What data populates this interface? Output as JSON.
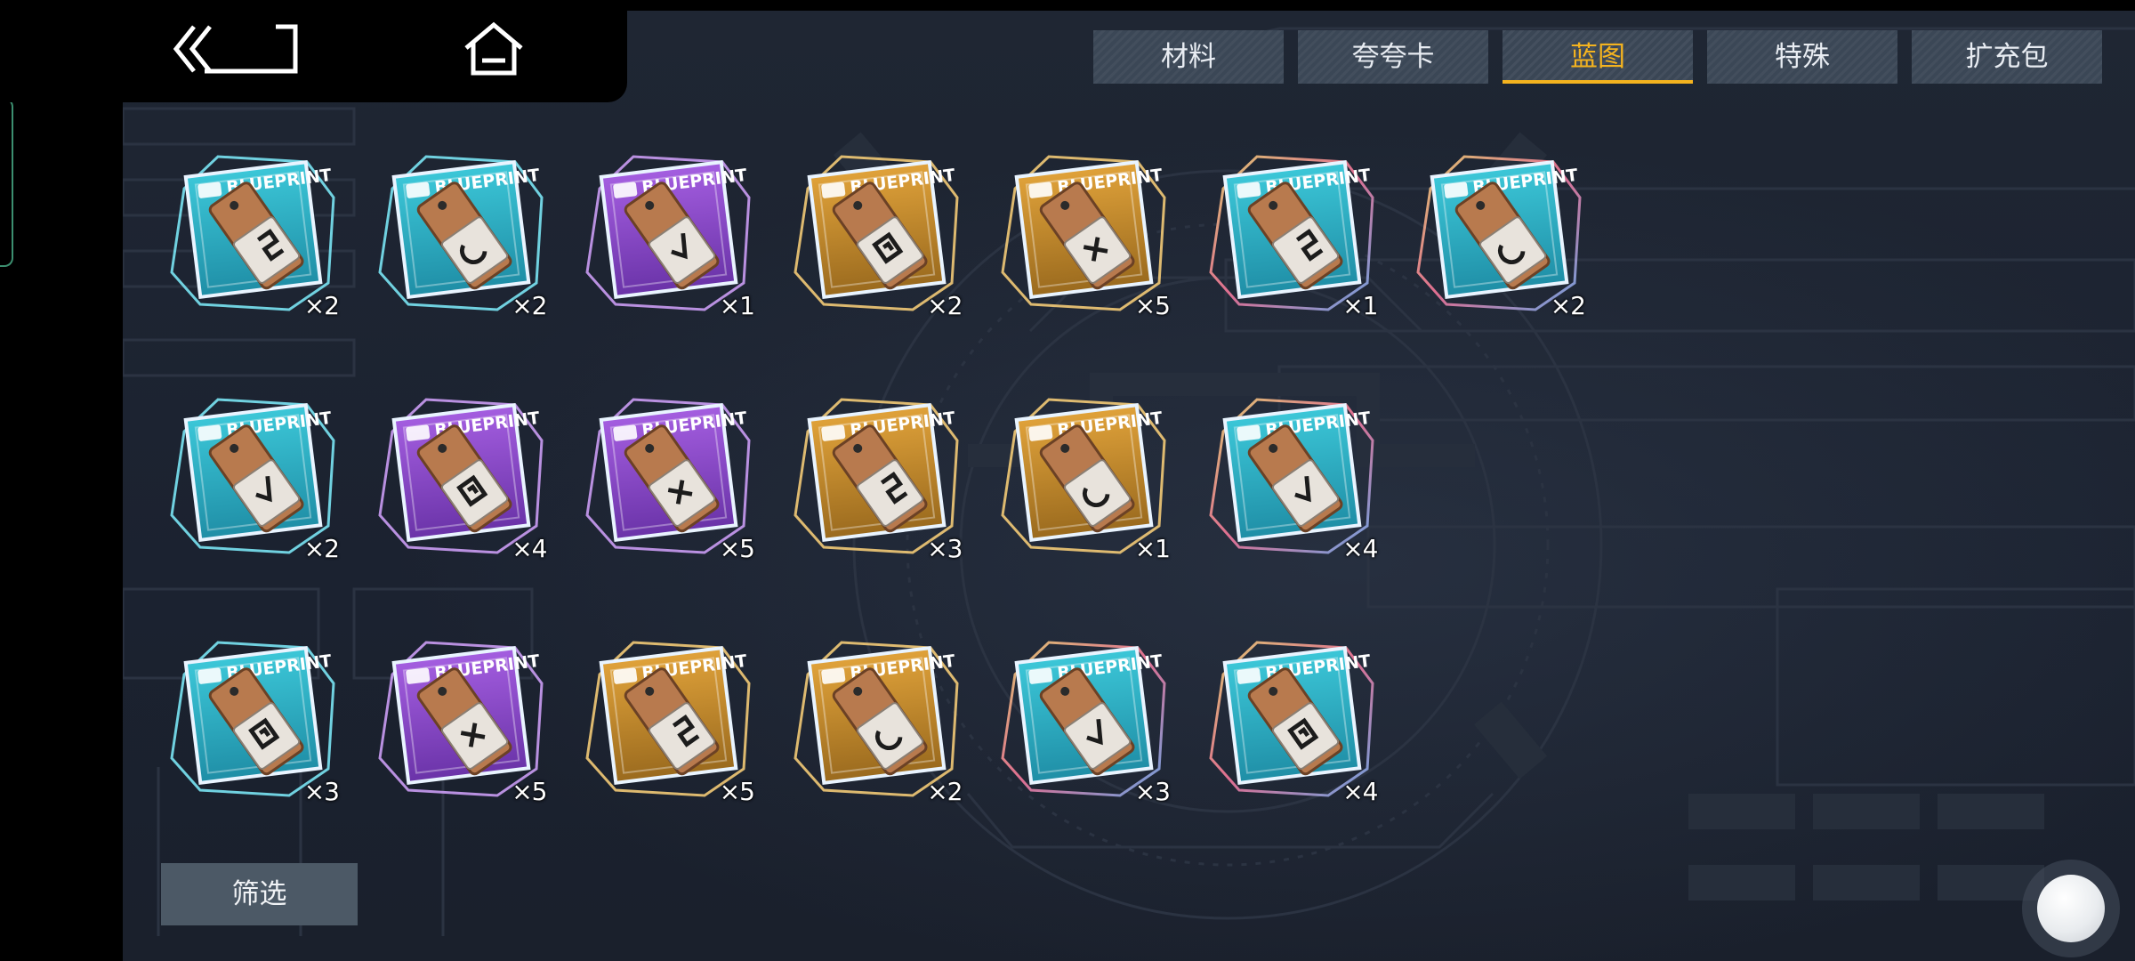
{
  "nav": {
    "back_icon": "double-chevron-left-icon",
    "home_icon": "home-icon"
  },
  "tabs": [
    {
      "label": "材料",
      "active": false
    },
    {
      "label": "夸夸卡",
      "active": false
    },
    {
      "label": "蓝图",
      "active": true
    },
    {
      "label": "特殊",
      "active": false
    },
    {
      "label": "扩充包",
      "active": false
    }
  ],
  "colors": {
    "accent": "#f4b31f",
    "tab_bg": "#3b4756",
    "panel_bg": "#1d2431",
    "rarity_blue": "#3cc7d8",
    "rarity_purple": "#a45ee0",
    "rarity_gold": "#e0a23a",
    "rarity_rainbow": "#3cc7d8"
  },
  "blueprint_label": "BLUEPRINT",
  "items": [
    {
      "rarity": "blue",
      "count": "×2"
    },
    {
      "rarity": "blue",
      "count": "×2"
    },
    {
      "rarity": "purple",
      "count": "×1"
    },
    {
      "rarity": "gold",
      "count": "×2"
    },
    {
      "rarity": "gold",
      "count": "×5"
    },
    {
      "rarity": "rainbow",
      "count": "×1"
    },
    {
      "rarity": "rainbow",
      "count": "×2"
    },
    {
      "rarity": "blue",
      "count": "×2"
    },
    {
      "rarity": "purple",
      "count": "×4"
    },
    {
      "rarity": "purple",
      "count": "×5"
    },
    {
      "rarity": "gold",
      "count": "×3"
    },
    {
      "rarity": "gold",
      "count": "×1"
    },
    {
      "rarity": "rainbow",
      "count": "×4"
    },
    {
      "rarity": "blue",
      "count": "×3"
    },
    {
      "rarity": "purple",
      "count": "×5"
    },
    {
      "rarity": "gold",
      "count": "×5"
    },
    {
      "rarity": "gold",
      "count": "×2"
    },
    {
      "rarity": "rainbow",
      "count": "×3"
    },
    {
      "rarity": "rainbow",
      "count": "×4"
    }
  ],
  "filter": {
    "label": "筛选"
  },
  "float_button": {
    "icon": "floating-assist-icon"
  }
}
